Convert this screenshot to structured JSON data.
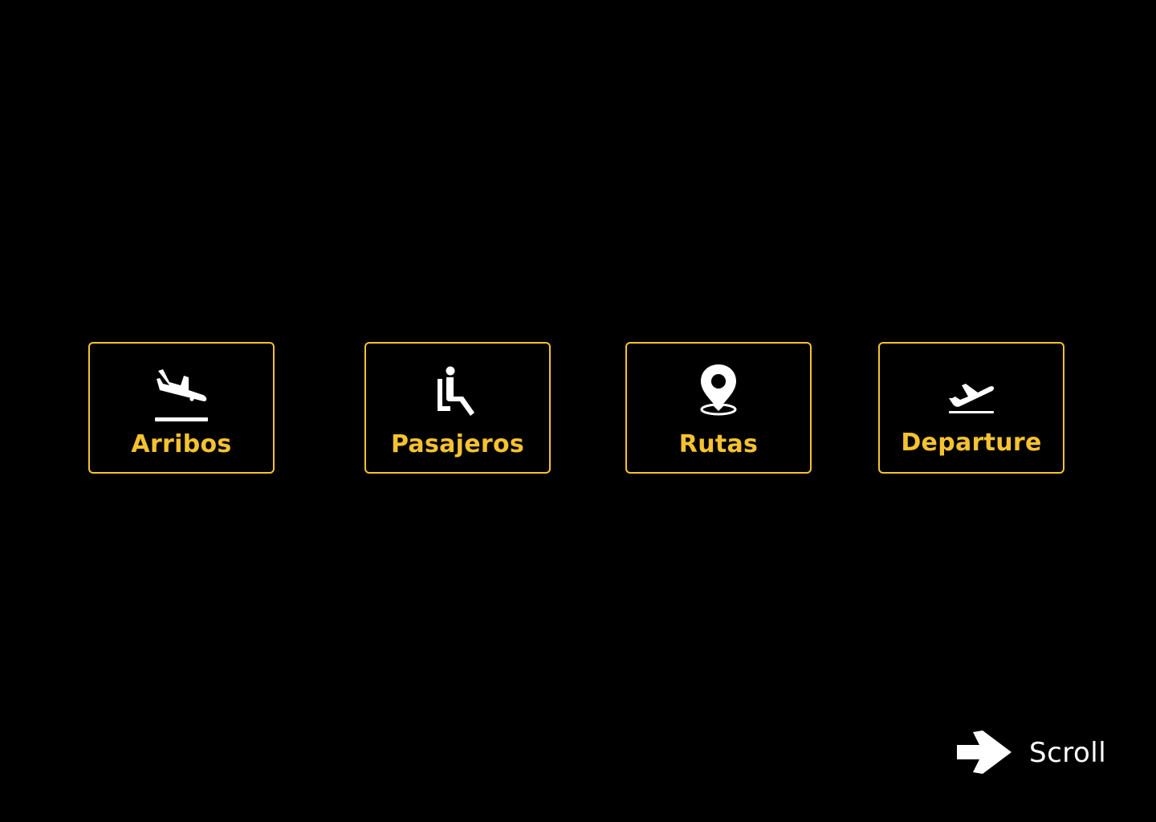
{
  "theme": {
    "background": "#000000",
    "accent": "#f5c230",
    "icon_color": "#ffffff"
  },
  "cards": [
    {
      "label": "Arribos",
      "icon": "airplane-arrival-icon"
    },
    {
      "label": "Pasajeros",
      "icon": "seated-passenger-icon"
    },
    {
      "label": "Rutas",
      "icon": "map-pin-icon"
    },
    {
      "label": "Departure",
      "icon": "airplane-departure-icon"
    }
  ],
  "scroll": {
    "label": "Scroll",
    "icon": "arrow-right-icon"
  }
}
